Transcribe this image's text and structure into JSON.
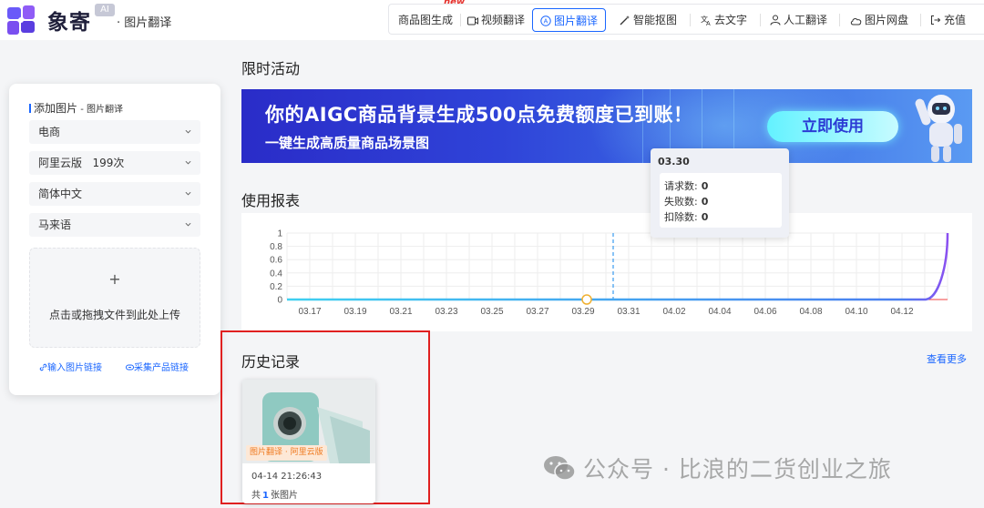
{
  "header": {
    "brand": "象寄",
    "ai_badge": "AI",
    "subtitle": "· 图片翻译",
    "new_badge": "new",
    "nav": [
      {
        "label": "商品图生成",
        "icon": "none"
      },
      {
        "label": "视频翻译",
        "icon": "video-icon"
      },
      {
        "label": "图片翻译",
        "icon": "translate-image-icon",
        "active": true
      },
      {
        "label": "智能抠图",
        "icon": "magic-wand-icon"
      },
      {
        "label": "去文字",
        "icon": "text-remove-icon"
      },
      {
        "label": "人工翻译",
        "icon": "user-icon"
      },
      {
        "label": "图片网盘",
        "icon": "cloud-icon"
      },
      {
        "label": "充值",
        "icon": "recharge-icon"
      }
    ]
  },
  "panel": {
    "title": "添加图片",
    "title_suffix": "- 图片翻译",
    "selects": [
      {
        "value": "电商"
      },
      {
        "value": "阿里云版   199次"
      },
      {
        "value": "简体中文"
      },
      {
        "value": "马来语"
      }
    ],
    "upload_plus": "+",
    "upload_text": "点击或拖拽文件到此处上传",
    "link_image": "输入图片链接",
    "link_product": "采集产品链接"
  },
  "promo": {
    "section_title": "限时活动",
    "headline": "你的AIGC商品背景生成500点免费额度已到账！",
    "subline": "一键生成高质量商品场景图",
    "button": "立即使用"
  },
  "usage": {
    "section_title": "使用报表",
    "tooltip": {
      "date": "03.30",
      "rows": [
        {
          "label": "请求数:",
          "value": "0"
        },
        {
          "label": "失败数:",
          "value": "0"
        },
        {
          "label": "扣除数:",
          "value": "0"
        }
      ]
    }
  },
  "chart_data": {
    "type": "line",
    "x_tick_labels": [
      "03.17",
      "03.19",
      "03.21",
      "03.23",
      "03.25",
      "03.27",
      "03.29",
      "03.31",
      "04.02",
      "04.04",
      "04.06",
      "04.08",
      "04.10",
      "04.12"
    ],
    "y_tick_labels": [
      "0",
      "0.2",
      "0.4",
      "0.6",
      "0.8",
      "1"
    ],
    "ylim": [
      0,
      1
    ],
    "grid": true,
    "highlight_x": "03.30",
    "series": [
      {
        "values": [
          0,
          0,
          0,
          0,
          0,
          0,
          0,
          0,
          0,
          0,
          0,
          0,
          0,
          0,
          0,
          0,
          0,
          0,
          0,
          0,
          0,
          0,
          0,
          0,
          0,
          0,
          0,
          0,
          0,
          1
        ],
        "color": "#3fd0f0"
      }
    ],
    "x": [
      "03.16",
      "03.17",
      "03.18",
      "03.19",
      "03.20",
      "03.21",
      "03.22",
      "03.23",
      "03.24",
      "03.25",
      "03.26",
      "03.27",
      "03.28",
      "03.29",
      "03.30",
      "03.31",
      "04.01",
      "04.02",
      "04.03",
      "04.04",
      "04.05",
      "04.06",
      "04.07",
      "04.08",
      "04.09",
      "04.10",
      "04.11",
      "04.12",
      "04.13",
      "04.14"
    ]
  },
  "history": {
    "section_title": "历史记录",
    "more": "查看更多",
    "card": {
      "tag": "图片翻译 · 阿里云版",
      "time": "04-14 21:26:43",
      "count_prefix": "共",
      "count": "1",
      "count_suffix": "张图片"
    }
  },
  "watermark": "公众号 · 比浪的二货创业之旅",
  "colors": {
    "accent": "#1a66ff",
    "banner": "#2f43d8",
    "highlight_frame": "#e02020",
    "tag": "#ef7a20"
  }
}
